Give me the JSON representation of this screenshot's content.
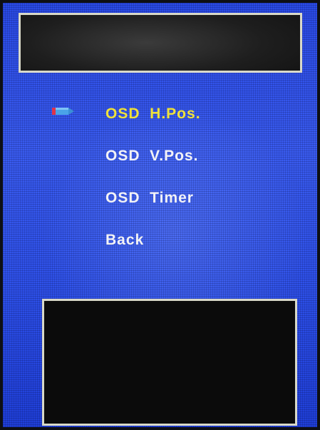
{
  "menu": {
    "items": [
      {
        "label": "OSD  H.Pos.",
        "selected": true
      },
      {
        "label": "OSD  V.Pos.",
        "selected": false
      },
      {
        "label": "OSD  Timer",
        "selected": false
      },
      {
        "label": "Back",
        "selected": false
      }
    ]
  },
  "icons": {
    "selection_cursor": "pencil-pointer-icon"
  },
  "colors": {
    "background": "#2f52ea",
    "selected_text": "#f0e23a",
    "normal_text": "#f2f2f6",
    "panel_border": "#d9d9c8",
    "cursor_red": "#e0334a",
    "cursor_blue": "#4aa3e8"
  }
}
